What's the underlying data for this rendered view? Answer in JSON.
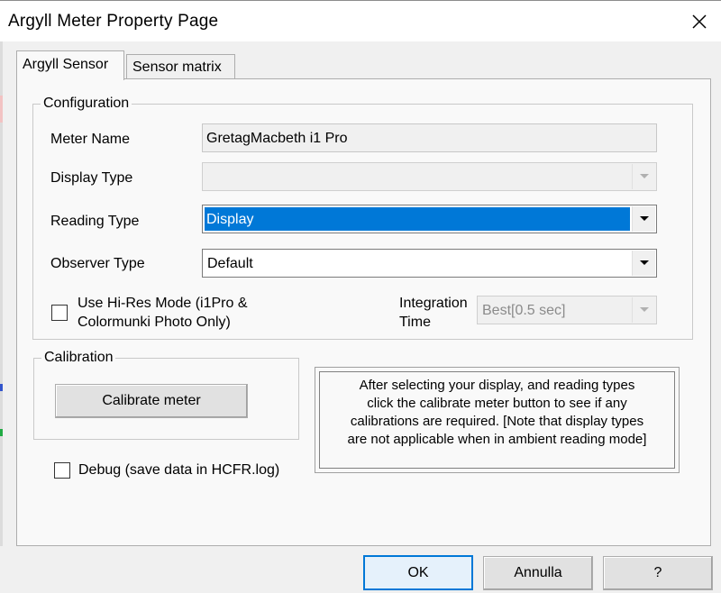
{
  "window": {
    "title": "Argyll Meter Property Page"
  },
  "tabs": [
    {
      "label": "Argyll Sensor",
      "active": true
    },
    {
      "label": "Sensor matrix",
      "active": false
    }
  ],
  "configuration": {
    "legend": "Configuration",
    "meter_name": {
      "label": "Meter Name",
      "value": "GretagMacbeth i1 Pro"
    },
    "display_type": {
      "label": "Display Type",
      "value": ""
    },
    "reading_type": {
      "label": "Reading Type",
      "value": "Display"
    },
    "observer_type": {
      "label": "Observer Type",
      "value": "Default"
    },
    "hires": {
      "label_line1": "Use Hi-Res Mode (i1Pro &",
      "label_line2": "Colormunki Photo Only)",
      "checked": false
    },
    "integration": {
      "label_line1": "Integration",
      "label_line2": "Time",
      "value": "Best[0.5 sec]"
    }
  },
  "calibration": {
    "legend": "Calibration",
    "button": "Calibrate meter",
    "info_lines": [
      "After selecting your display, and reading types",
      "click the calibrate meter button to see if any",
      "calibrations are required. [Note that display types",
      "are not applicable when in ambient reading mode]"
    ]
  },
  "debug": {
    "label": "Debug (save data in HCFR.log)",
    "checked": false
  },
  "footer": {
    "ok": "OK",
    "cancel": "Annulla",
    "help": "?"
  },
  "colors": {
    "accent": "#0078d7",
    "window_bg": "#f0f0f0",
    "panel_bg": "#f9f9f9"
  }
}
